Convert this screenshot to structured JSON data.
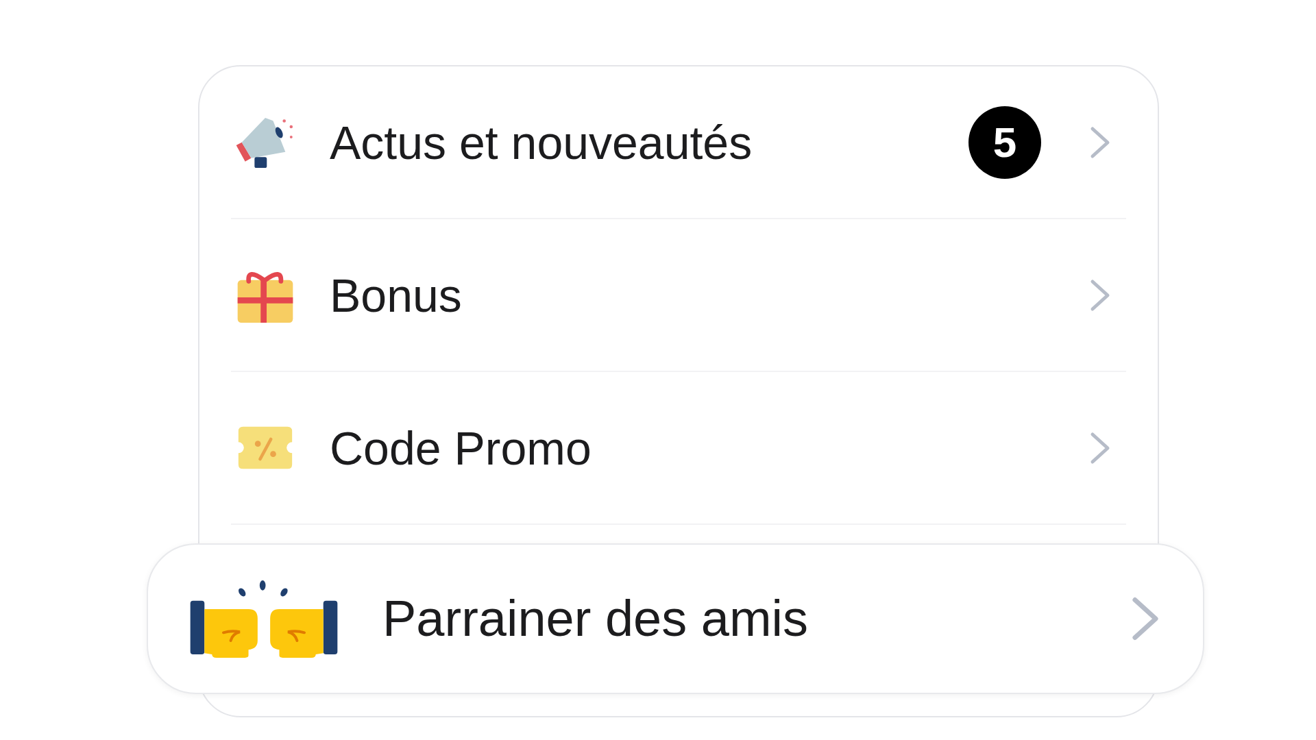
{
  "menu": {
    "items": [
      {
        "kind": "news",
        "label": "Actus et nouveautés",
        "badge": "5"
      },
      {
        "kind": "gift",
        "label": "Bonus"
      },
      {
        "kind": "promo",
        "label": "Code Promo"
      }
    ]
  },
  "featured_item": {
    "kind": "referral",
    "label": "Parrainer des amis"
  }
}
